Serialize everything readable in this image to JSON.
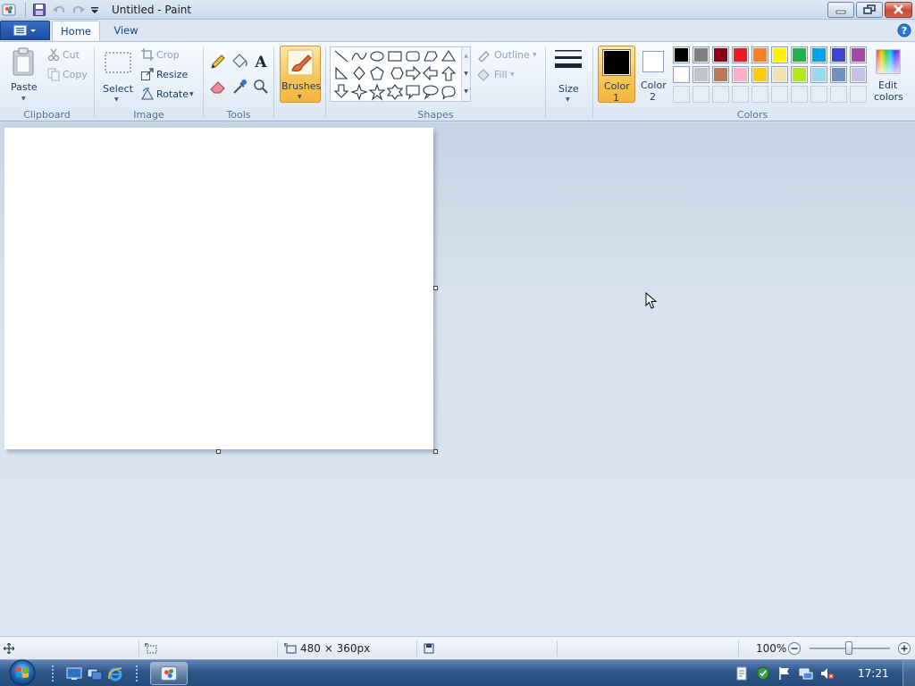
{
  "window": {
    "title": "Untitled - Paint"
  },
  "tabs": [
    {
      "label": "Home",
      "active": true
    },
    {
      "label": "View",
      "active": false
    }
  ],
  "clipboard": {
    "paste": "Paste",
    "cut": "Cut",
    "copy": "Copy",
    "group": "Clipboard"
  },
  "image": {
    "select": "Select",
    "crop": "Crop",
    "resize": "Resize",
    "rotate": "Rotate",
    "group": "Image"
  },
  "tools": {
    "group": "Tools",
    "items": [
      "pencil-icon",
      "fill-bucket-icon",
      "text-icon",
      "eraser-icon",
      "color-picker-icon",
      "magnifier-icon"
    ]
  },
  "brushes": {
    "label": "Brushes"
  },
  "shapes": {
    "group": "Shapes",
    "outline": "Outline",
    "fill": "Fill"
  },
  "size": {
    "label": "Size"
  },
  "colors": {
    "group": "Colors",
    "color1_line1": "Color",
    "color1_line2": "1",
    "color2_line1": "Color",
    "color2_line2": "2",
    "edit_line1": "Edit",
    "edit_line2": "colors",
    "color1": "#000000",
    "color2": "#ffffff",
    "palette_row1": [
      "#000000",
      "#7f7f7f",
      "#880015",
      "#ed1c24",
      "#ff7f27",
      "#fff200",
      "#22b14c",
      "#00a2e8",
      "#3f48cc",
      "#a349a4"
    ],
    "palette_row2": [
      "#ffffff",
      "#c3c3c3",
      "#b97a57",
      "#ffaec9",
      "#ffc90e",
      "#efe4b0",
      "#b5e61d",
      "#99d9ea",
      "#7092be",
      "#c8bfe7"
    ]
  },
  "status": {
    "canvas_size": "480 × 360px",
    "zoom": "100%"
  },
  "taskbar": {
    "clock": "17:21"
  }
}
